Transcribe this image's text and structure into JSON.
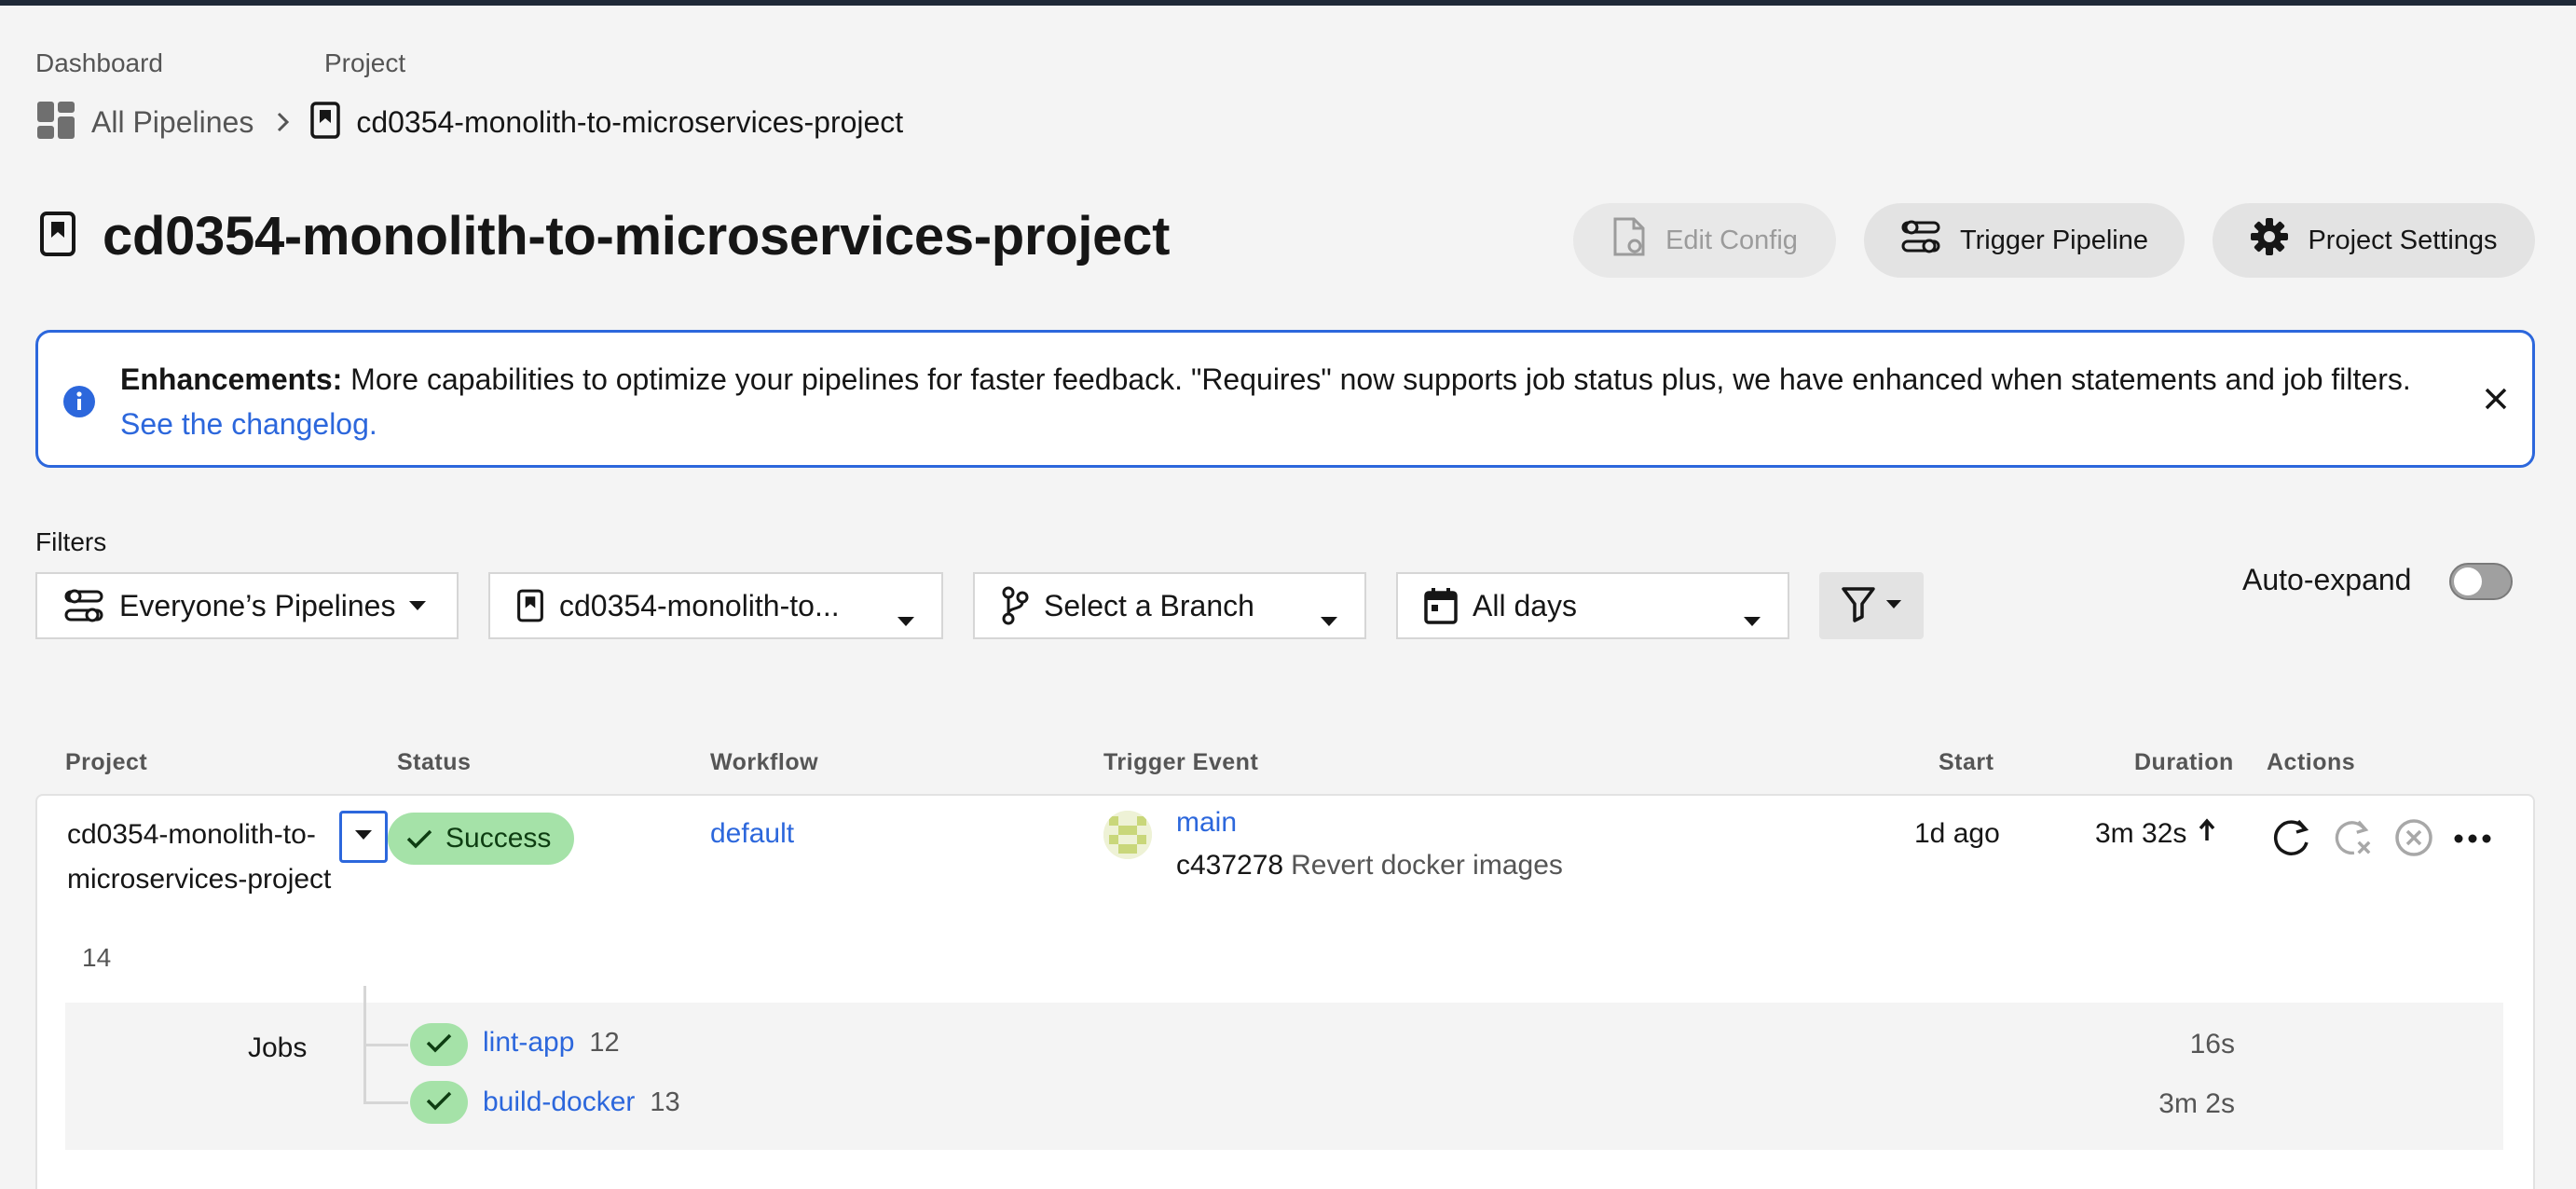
{
  "breadcrumb": {
    "dashboard_label": "Dashboard",
    "project_label": "Project",
    "all_pipelines": "All Pipelines",
    "current_project": "cd0354-monolith-to-microservices-project"
  },
  "header": {
    "title": "cd0354-monolith-to-microservices-project",
    "edit_config": "Edit Config",
    "trigger_pipeline": "Trigger Pipeline",
    "project_settings": "Project Settings"
  },
  "banner": {
    "bold": "Enhancements:",
    "text": " More capabilities to optimize your pipelines for faster feedback. \"Requires\" now supports job status plus, we have enhanced when statements and job filters. ",
    "link": "See the changelog."
  },
  "filters": {
    "label": "Filters",
    "pipelines": "Everyone’s Pipelines",
    "project": "cd0354-monolith-to...",
    "branch": "Select a Branch",
    "days": "All days",
    "auto_expand": "Auto-expand",
    "auto_expand_on": false
  },
  "table": {
    "headers": {
      "project": "Project",
      "status": "Status",
      "workflow": "Workflow",
      "trigger": "Trigger Event",
      "start": "Start",
      "duration": "Duration",
      "actions": "Actions"
    },
    "row": {
      "project_name": "cd0354-monolith-to-microservices-project",
      "number": "14",
      "status": "Success",
      "workflow": "default",
      "branch": "main",
      "commit_hash": "c437278",
      "commit_msg": "Revert docker images",
      "start": "1d ago",
      "duration": "3m 32s"
    },
    "jobs_label": "Jobs",
    "jobs": [
      {
        "name": "lint-app",
        "number": "12",
        "duration": "16s"
      },
      {
        "name": "build-docker",
        "number": "13",
        "duration": "3m 2s"
      }
    ]
  },
  "colors": {
    "accent": "#2c67dc",
    "success_bg": "#a5e2a8"
  }
}
